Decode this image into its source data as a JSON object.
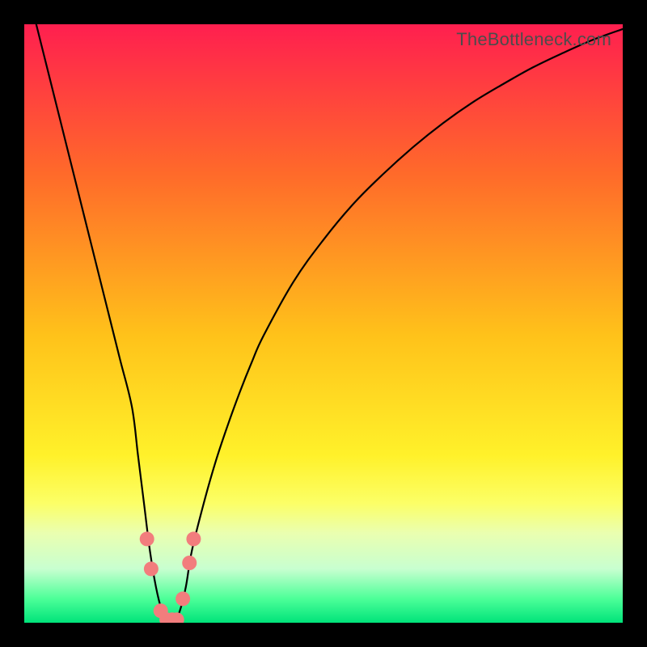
{
  "watermark": "TheBottleneck.com",
  "chart_data": {
    "type": "line",
    "title": "",
    "xlabel": "",
    "ylabel": "",
    "xlim": [
      0,
      100
    ],
    "ylim": [
      0,
      100
    ],
    "x": [
      0,
      2,
      4,
      6,
      8,
      10,
      12,
      14,
      16,
      18,
      19,
      20,
      21,
      22,
      23,
      24,
      25,
      26,
      27,
      28,
      30,
      32,
      34,
      36,
      38,
      40,
      45,
      50,
      55,
      60,
      65,
      70,
      75,
      80,
      85,
      90,
      95,
      100
    ],
    "values": [
      108,
      100,
      92,
      84,
      76,
      68,
      60,
      52,
      44,
      36,
      28,
      20,
      12,
      6,
      2,
      0,
      0,
      2,
      6,
      12,
      20,
      27,
      33,
      38.5,
      43.5,
      48,
      57,
      64,
      70,
      75,
      79.5,
      83.5,
      87,
      90,
      92.8,
      95.2,
      97.4,
      99.2
    ],
    "markers": {
      "style": "circle",
      "color": "#f27d7d",
      "radius_px": 9,
      "x": [
        20.5,
        21.2,
        22.8,
        23.8,
        24.7,
        25.5,
        26.5,
        27.6,
        28.3
      ],
      "y": [
        14,
        9,
        2,
        0.5,
        0.5,
        0.5,
        4,
        10,
        14
      ]
    },
    "gradient_stops": [
      {
        "pct": 0,
        "color": "#ff1f4f"
      },
      {
        "pct": 25,
        "color": "#ff6a2a"
      },
      {
        "pct": 52,
        "color": "#ffc21a"
      },
      {
        "pct": 72,
        "color": "#fff12a"
      },
      {
        "pct": 80,
        "color": "#fcff66"
      },
      {
        "pct": 85,
        "color": "#eaffb0"
      },
      {
        "pct": 91,
        "color": "#c8ffd0"
      },
      {
        "pct": 96,
        "color": "#4cff98"
      },
      {
        "pct": 100,
        "color": "#00e37a"
      }
    ]
  }
}
